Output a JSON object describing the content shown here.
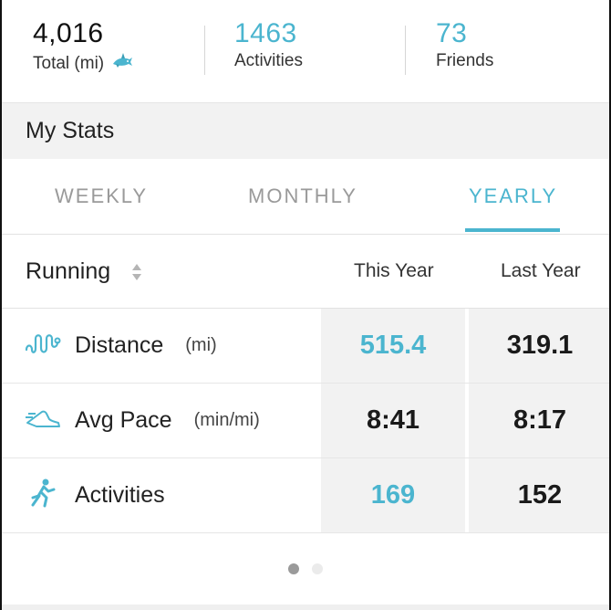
{
  "summary": {
    "total": {
      "value": "4,016",
      "label": "Total (mi)",
      "icon": "shark-icon"
    },
    "activities": {
      "value": "1463",
      "label": "Activities"
    },
    "friends": {
      "value": "73",
      "label": "Friends"
    }
  },
  "section": {
    "title": "My Stats"
  },
  "tabs": {
    "weekly": "WEEKLY",
    "monthly": "MONTHLY",
    "yearly": "YEARLY",
    "active": "yearly"
  },
  "table": {
    "sport": "Running",
    "columns": {
      "this_year": "This Year",
      "last_year": "Last Year"
    },
    "rows": [
      {
        "metric": "Distance",
        "unit": "(mi)",
        "icon": "route-icon",
        "this_year": "515.4",
        "last_year": "319.1"
      },
      {
        "metric": "Avg Pace",
        "unit": "(min/mi)",
        "icon": "shoe-icon",
        "this_year": "8:41",
        "last_year": "8:17"
      },
      {
        "metric": "Activities",
        "unit": "",
        "icon": "runner-icon",
        "this_year": "169",
        "last_year": "152"
      }
    ]
  },
  "pager": {
    "pages": 2,
    "current": 1
  },
  "colors": {
    "accent": "#4bb5cf",
    "cell_bg": "#f2f2f2",
    "muted": "#9a9a9a"
  }
}
